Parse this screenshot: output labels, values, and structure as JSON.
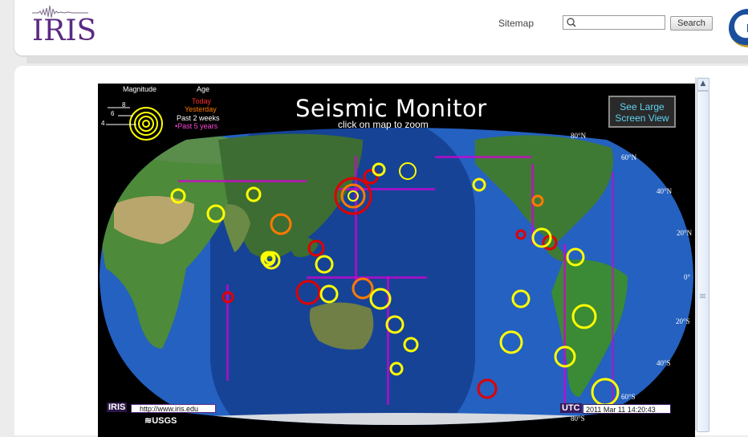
{
  "header": {
    "logo_text": "IRIS",
    "sitemap_label": "Sitemap",
    "search_placeholder": "",
    "search_button_label": "Search"
  },
  "monitor": {
    "title": "Seismic Monitor",
    "subtitle": "click on map to zoom",
    "large_view_line1": "See Large",
    "large_view_line2": "Screen View",
    "legend": {
      "magnitude_label": "Magnitude",
      "age_label": "Age",
      "magnitudes": [
        "8",
        "6",
        "4"
      ],
      "ages": [
        {
          "label": "Today",
          "color": "#ff2b2b"
        },
        {
          "label": "Yesterday",
          "color": "#ff7a00"
        },
        {
          "label": "Past 2 weeks",
          "color": "#ffffff"
        },
        {
          "label": "Past 5 years",
          "color": "#ff44dd"
        }
      ]
    },
    "footer": {
      "iris_tag": "IRIS",
      "url": "http://www.iris.edu",
      "usgs_tag": "USGS",
      "utc_label": "UTC",
      "timestamp": "2011 Mar 11 14:20:43"
    },
    "latitudes": [
      "80°N",
      "60°N",
      "40°N",
      "20°N",
      "0°",
      "20°S",
      "40°S",
      "60°S",
      "80°S"
    ]
  },
  "colors": {
    "quake_ring_yellow": "#ffff00",
    "quake_today_red": "#e00000",
    "quake_yesterday_orange": "#ff7a00",
    "historic_dots_magenta": "#d400d4",
    "ocean_blue": "#1e55b0",
    "land_green": "#3f7a35"
  }
}
